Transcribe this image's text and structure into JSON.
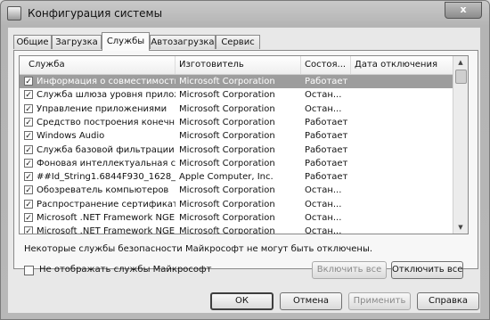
{
  "window": {
    "title": "Конфигурация системы",
    "close_glyph": "x"
  },
  "tabs": [
    "Общие",
    "Загрузка",
    "Службы",
    "Автозагрузка",
    "Сервис"
  ],
  "active_tab": "Службы",
  "table": {
    "columns": [
      "Служба",
      "Изготовитель",
      "Состоя...",
      "Дата отключения"
    ],
    "rows": [
      {
        "name": "Информация о совместимости ...",
        "maker": "Microsoft Corporation",
        "state": "Работает",
        "date": "",
        "checked": "✓",
        "selected": true
      },
      {
        "name": "Служба шлюза уровня прилож...",
        "maker": "Microsoft Corporation",
        "state": "Остан...",
        "date": "",
        "checked": "✓",
        "selected": false
      },
      {
        "name": "Управление приложениями",
        "maker": "Microsoft Corporation",
        "state": "Остан...",
        "date": "",
        "checked": "✓",
        "selected": false
      },
      {
        "name": "Средство построения конечн...",
        "maker": "Microsoft Corporation",
        "state": "Работает",
        "date": "",
        "checked": "✓",
        "selected": false
      },
      {
        "name": "Windows Audio",
        "maker": "Microsoft Corporation",
        "state": "Работает",
        "date": "",
        "checked": "✓",
        "selected": false
      },
      {
        "name": "Служба базовой фильтрации",
        "maker": "Microsoft Corporation",
        "state": "Работает",
        "date": "",
        "checked": "✓",
        "selected": false
      },
      {
        "name": "Фоновая интеллектуальная с...",
        "maker": "Microsoft Corporation",
        "state": "Работает",
        "date": "",
        "checked": "✓",
        "selected": false
      },
      {
        "name": "##Id_String1.6844F930_1628_...",
        "maker": "Apple Computer, Inc.",
        "state": "Работает",
        "date": "",
        "checked": "✓",
        "selected": false
      },
      {
        "name": "Обозреватель компьютеров",
        "maker": "Microsoft Corporation",
        "state": "Остан...",
        "date": "",
        "checked": "✓",
        "selected": false
      },
      {
        "name": "Распространение сертификата",
        "maker": "Microsoft Corporation",
        "state": "Остан...",
        "date": "",
        "checked": "✓",
        "selected": false
      },
      {
        "name": "Microsoft .NET Framework NGEN...",
        "maker": "Microsoft Corporation",
        "state": "Остан...",
        "date": "",
        "checked": "✓",
        "selected": false
      },
      {
        "name": "Microsoft .NET Framework NGEN...",
        "maker": "Microsoft Corporation",
        "state": "Остан...",
        "date": "",
        "checked": "✓",
        "selected": false
      }
    ]
  },
  "scroll": {
    "up_glyph": "▲",
    "down_glyph": "▼"
  },
  "note": "Некоторые службы безопасности Майкрософт не могут быть отключены.",
  "hide_ms_label": "Не отображать службы Майкрософт",
  "buttons": {
    "enable_all": "Включить все",
    "disable_all": "Отключить все",
    "ok": "ОК",
    "cancel": "Отмена",
    "apply": "Применить",
    "help": "Справка"
  }
}
